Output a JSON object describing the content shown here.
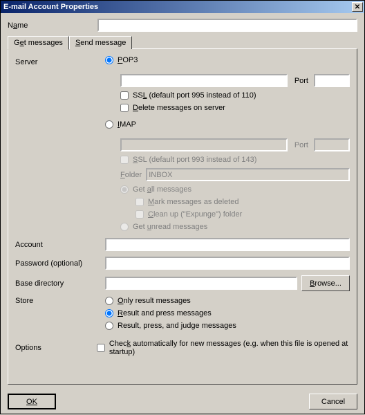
{
  "title": "E-mail Account Properties",
  "name_label_pre": "N",
  "name_label_und": "a",
  "name_label_post": "me",
  "name_value": "",
  "tabs": {
    "get_pre": "G",
    "get_und": "e",
    "get_post": "t messages",
    "send_und": "S",
    "send_post": "end message"
  },
  "server_label": "Server",
  "pop3": {
    "und": "P",
    "post": "OP3",
    "selected": true
  },
  "pop3_server_value": "",
  "pop3_port_label": "Port",
  "pop3_port_value": "",
  "pop3_ssl_pre": "SS",
  "pop3_ssl_und": "L",
  "pop3_ssl_post": " (default port 995 instead of 110)",
  "pop3_delete_und": "D",
  "pop3_delete_post": "elete messages on server",
  "imap": {
    "und": "I",
    "post": "MAP",
    "selected": false
  },
  "imap_server_value": "",
  "imap_port_label": "Port",
  "imap_port_value": "",
  "imap_ssl_pre": "",
  "imap_ssl_und": "S",
  "imap_ssl_post": "SL (default port 993 instead of 143)",
  "folder_und": "F",
  "folder_post": "older",
  "folder_value": "INBOX",
  "get_all_pre": "Get ",
  "get_all_und": "a",
  "get_all_post": "ll messages",
  "mark_und": "M",
  "mark_post": "ark messages as deleted",
  "clean_und": "C",
  "clean_post": "lean up (\"Expunge\") folder",
  "unread_pre": "Get ",
  "unread_und": "u",
  "unread_post": "nread messages",
  "account_label": "Account",
  "account_value": "",
  "password_label": "Password (optional)",
  "password_value": "",
  "base_dir_label": "Base directory",
  "base_dir_value": "",
  "browse_und": "B",
  "browse_post": "rowse...",
  "store_label": "Store",
  "store_only_und": "O",
  "store_only_post": "nly result messages",
  "store_rp_und": "R",
  "store_rp_post": "esult and press messages",
  "store_rpj_pre": "Result, press, and ",
  "store_rpj_und": "j",
  "store_rpj_post": "udge messages",
  "options_label": "Options",
  "check_auto_pre": "Chec",
  "check_auto_und": "k",
  "check_auto_post": " automatically for new messages (e.g. when this file is opened at startup)",
  "ok_label": "OK",
  "cancel_label": "Cancel"
}
